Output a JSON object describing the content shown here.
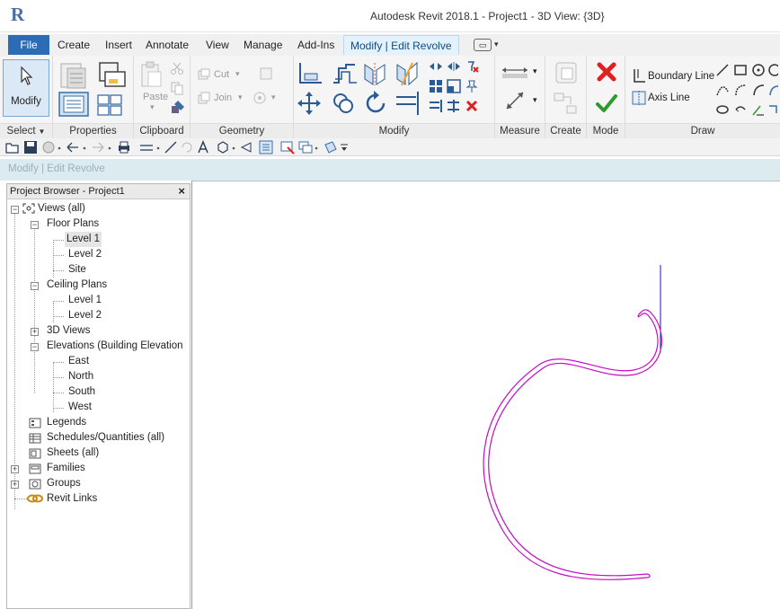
{
  "app": {
    "logo_letter": "R",
    "title": "Autodesk Revit 2018.1 -    Project1 - 3D View: {3D}"
  },
  "menu": {
    "file": "File",
    "tabs": [
      "Create",
      "Insert",
      "Annotate",
      "View",
      "Manage",
      "Add-Ins",
      "Modify | Edit Revolve"
    ]
  },
  "ribbon": {
    "modify_button": "Modify",
    "paste": "Paste",
    "cut": "Cut",
    "join": "Join",
    "boundary_line": "Boundary Line",
    "axis_line": "Axis Line",
    "panels": {
      "select": "Select",
      "properties": "Properties",
      "clipboard": "Clipboard",
      "geometry": "Geometry",
      "modify": "Modify",
      "measure": "Measure",
      "create": "Create",
      "mode": "Mode",
      "draw": "Draw"
    }
  },
  "options_bar": {
    "context_label": "Modify | Edit Revolve"
  },
  "project_browser": {
    "title": "Project Browser - Project1",
    "close": "×",
    "tree": {
      "views_all": "Views (all)",
      "floor_plans": "Floor Plans",
      "floor_level_1": "Level 1",
      "floor_level_2": "Level 2",
      "floor_site": "Site",
      "ceiling_plans": "Ceiling Plans",
      "ceiling_level_1": "Level 1",
      "ceiling_level_2": "Level 2",
      "views_3d": "3D Views",
      "elevations": "Elevations (Building Elevation",
      "east": "East",
      "north": "North",
      "south": "South",
      "west": "West",
      "legends": "Legends",
      "schedules": "Schedules/Quantities (all)",
      "sheets": "Sheets (all)",
      "families": "Families",
      "groups": "Groups",
      "revit_links": "Revit Links"
    }
  },
  "colors": {
    "file_tab": "#2b6cb5",
    "sketch_profile": "#c40ec4",
    "axis_line": "#1a1aa8",
    "cancel_mode": "#e02020",
    "finish_mode": "#2e9a2e"
  }
}
